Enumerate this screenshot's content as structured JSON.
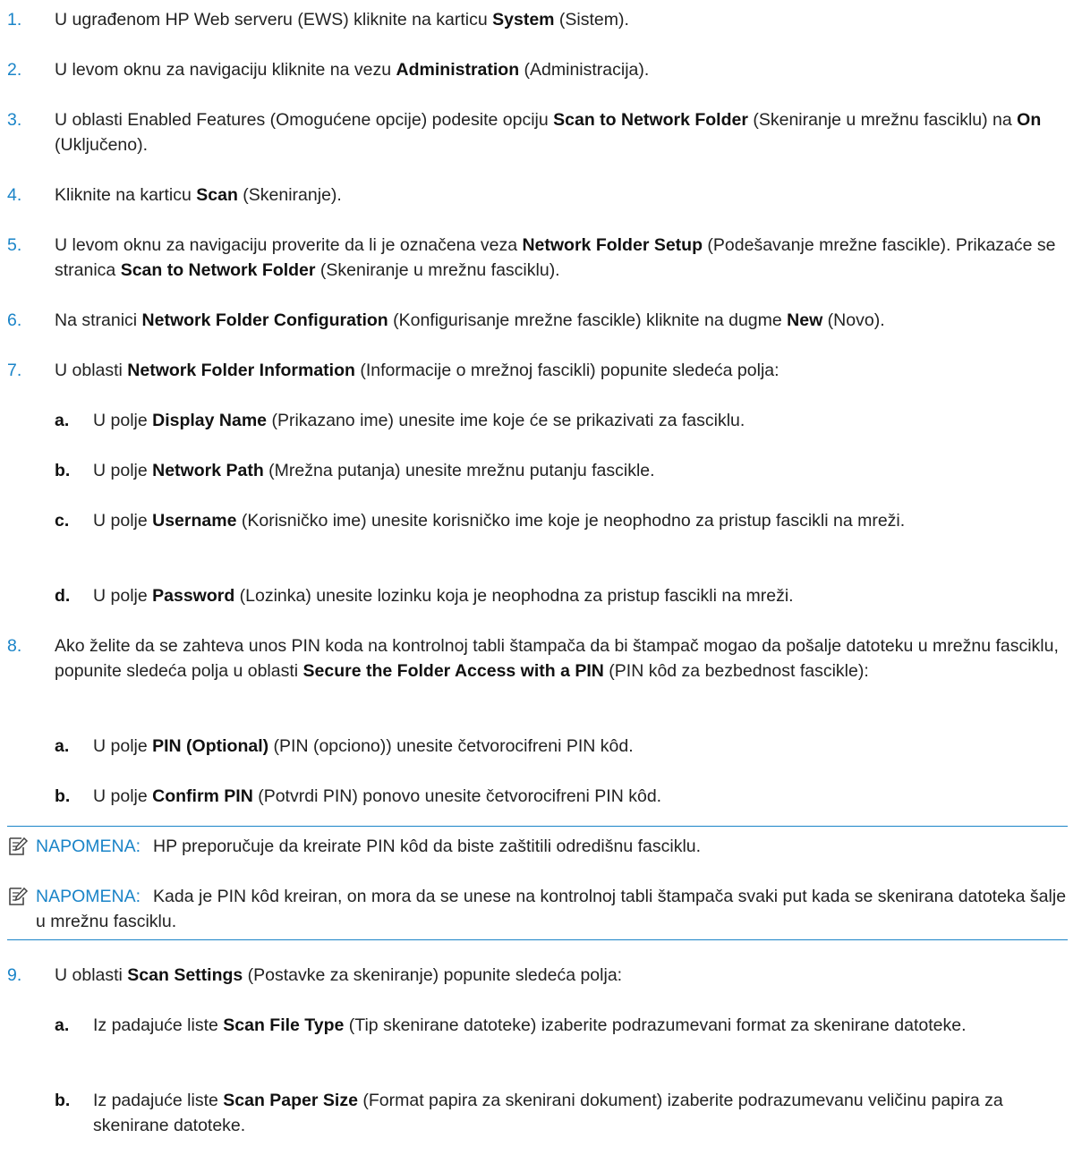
{
  "steps": [
    {
      "num": "1.",
      "parts": [
        {
          "t": "U ugrađenom HP Web serveru (EWS) kliknite na karticu "
        },
        {
          "b": "System"
        },
        {
          "t": " (Sistem)."
        }
      ]
    },
    {
      "num": "2.",
      "parts": [
        {
          "t": "U levom oknu za navigaciju kliknite na vezu "
        },
        {
          "b": "Administration"
        },
        {
          "t": " (Administracija)."
        }
      ]
    },
    {
      "num": "3.",
      "parts": [
        {
          "t": "U oblasti Enabled Features (Omogućene opcije) podesite opciju "
        },
        {
          "b": "Scan to Network Folder"
        },
        {
          "t": " (Skeniranje u mrežnu fasciklu) na "
        },
        {
          "b": "On"
        },
        {
          "t": " (Uključeno)."
        }
      ]
    },
    {
      "num": "4.",
      "parts": [
        {
          "t": "Kliknite na karticu "
        },
        {
          "b": "Scan"
        },
        {
          "t": " (Skeniranje)."
        }
      ]
    },
    {
      "num": "5.",
      "parts": [
        {
          "t": "U levom oknu za navigaciju proverite da li je označena veza "
        },
        {
          "b": "Network Folder Setup"
        },
        {
          "t": " (Podešavanje mrežne fascikle). Prikazaće se stranica "
        },
        {
          "b": "Scan to Network Folder"
        },
        {
          "t": " (Skeniranje u mrežnu fasciklu)."
        }
      ]
    },
    {
      "num": "6.",
      "parts": [
        {
          "t": "Na stranici "
        },
        {
          "b": "Network Folder Configuration"
        },
        {
          "t": " (Konfigurisanje mrežne fascikle) kliknite na dugme "
        },
        {
          "b": "New"
        },
        {
          "t": " (Novo)."
        }
      ]
    },
    {
      "num": "7.",
      "parts": [
        {
          "t": "U oblasti "
        },
        {
          "b": "Network Folder Information"
        },
        {
          "t": " (Informacije o mrežnoj fascikli) popunite sledeća polja:"
        }
      ]
    },
    {
      "num": "a.",
      "parts": [
        {
          "t": "U polje "
        },
        {
          "b": "Display Name"
        },
        {
          "t": " (Prikazano ime) unesite ime koje će se prikazivati za fasciklu."
        }
      ]
    },
    {
      "num": "b.",
      "parts": [
        {
          "t": "U polje "
        },
        {
          "b": "Network Path"
        },
        {
          "t": " (Mrežna putanja) unesite mrežnu putanju fascikle."
        }
      ]
    },
    {
      "num": "c.",
      "parts": [
        {
          "t": "U polje "
        },
        {
          "b": "Username"
        },
        {
          "t": " (Korisničko ime) unesite korisničko ime koje je neophodno za pristup fascikli na mreži."
        }
      ]
    },
    {
      "num": "d.",
      "parts": [
        {
          "t": "U polje "
        },
        {
          "b": "Password"
        },
        {
          "t": " (Lozinka) unesite lozinku koja je neophodna za pristup fascikli na mreži."
        }
      ]
    },
    {
      "num": "8.",
      "parts": [
        {
          "t": "Ako želite da se zahteva unos PIN koda na kontrolnoj tabli štampača da bi štampač mogao da pošalje datoteku u mrežnu fasciklu, popunite sledeća polja u oblasti "
        },
        {
          "b": "Secure the Folder Access with a PIN"
        },
        {
          "t": " (PIN kôd za bezbednost fascikle):"
        }
      ]
    },
    {
      "num": "a.",
      "parts": [
        {
          "t": "U polje "
        },
        {
          "b": "PIN (Optional)"
        },
        {
          "t": " (PIN (opciono)) unesite četvorocifreni PIN kôd."
        }
      ]
    },
    {
      "num": "b.",
      "parts": [
        {
          "t": "U polje "
        },
        {
          "b": "Confirm PIN"
        },
        {
          "t": " (Potvrdi PIN) ponovo unesite četvorocifreni PIN kôd."
        }
      ]
    },
    {
      "num": "9.",
      "parts": [
        {
          "t": "U oblasti "
        },
        {
          "b": "Scan Settings"
        },
        {
          "t": " (Postavke za skeniranje) popunite sledeća polja:"
        }
      ]
    },
    {
      "num": "a.",
      "parts": [
        {
          "t": "Iz padajuće liste "
        },
        {
          "b": "Scan File Type"
        },
        {
          "t": " (Tip skenirane datoteke) izaberite podrazumevani format za skenirane datoteke."
        }
      ]
    },
    {
      "num": "b.",
      "parts": [
        {
          "t": "Iz padajuće liste "
        },
        {
          "b": "Scan Paper Size"
        },
        {
          "t": " (Format papira za skenirani dokument) izaberite podrazumevanu veličinu papira za skenirane datoteke."
        }
      ]
    }
  ],
  "notes": [
    {
      "label": "NAPOMENA:",
      "text": "HP preporučuje da kreirate PIN kôd da biste zaštitili odredišnu fasciklu."
    },
    {
      "label": "NAPOMENA:",
      "text": "Kada je PIN kôd kreiran, on mora da se unese na kontrolnoj tabli štampača svaki put kada se skenirana datoteka šalje u mrežnu fasciklu."
    }
  ],
  "colors": {
    "accent": "#1a84c8",
    "text": "#222222"
  },
  "icons": {
    "note": "note-pencil-icon"
  }
}
